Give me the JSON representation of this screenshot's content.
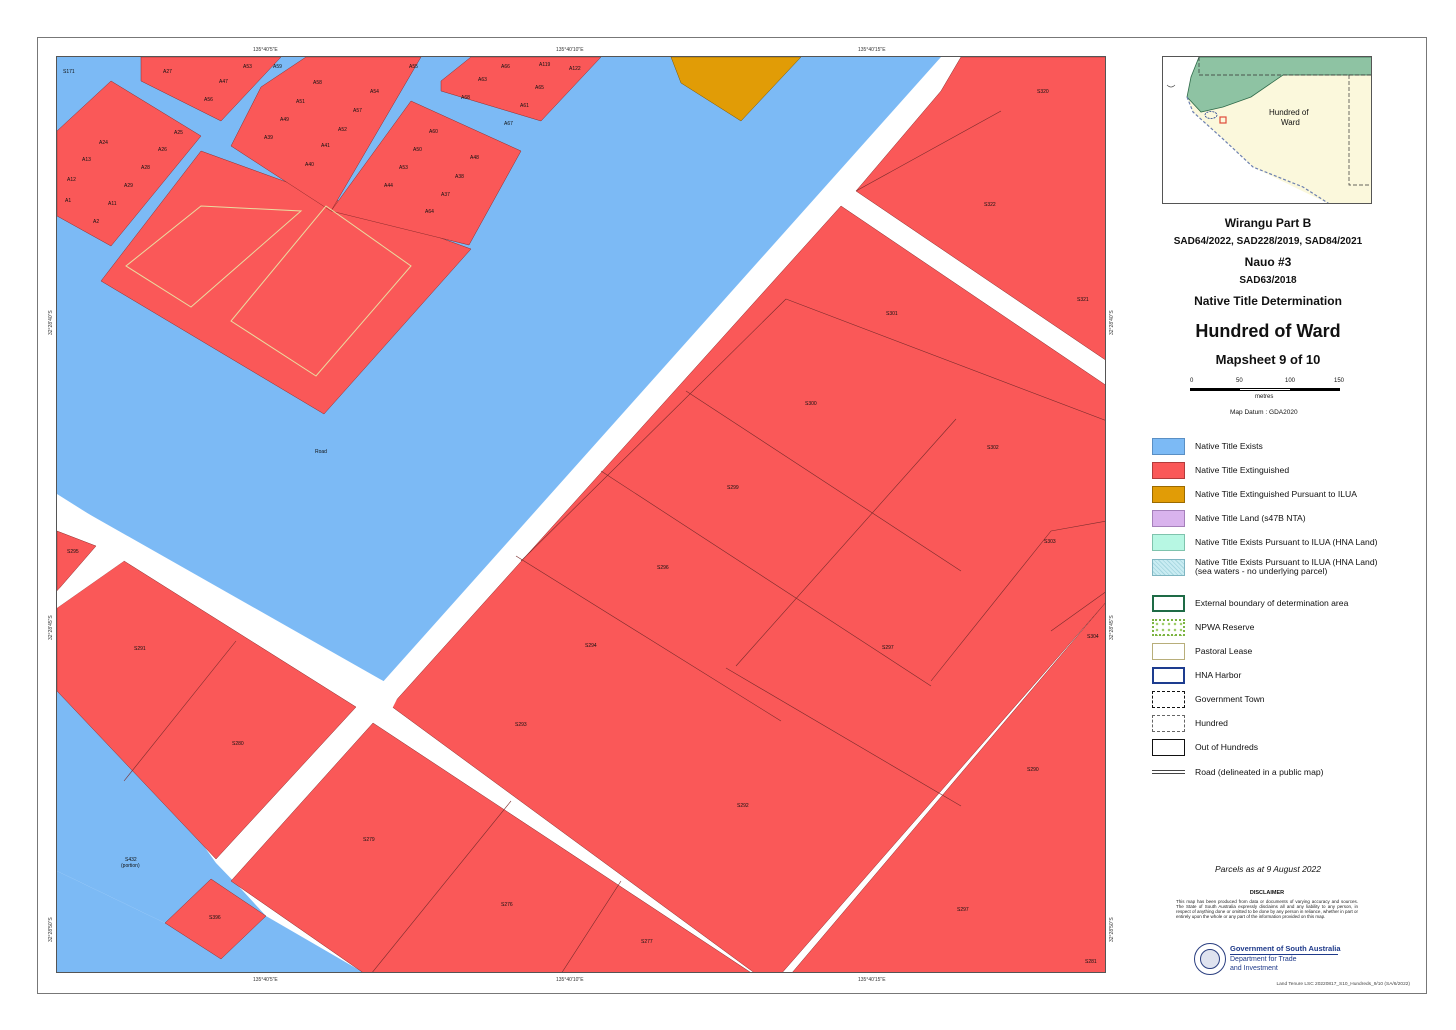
{
  "map": {
    "coords_top": [
      "135°40'5\"E",
      "135°40'10\"E",
      "135°40'15\"E"
    ],
    "coords_bottom": [
      "135°40'5\"E",
      "135°40'10\"E",
      "135°40'15\"E"
    ],
    "coords_left": [
      "32°28'40\"S",
      "32°28'45\"S",
      "32°28'50\"S"
    ],
    "coords_right": [
      "32°28'40\"S",
      "32°28'45\"S",
      "32°28'50\"S"
    ],
    "parcel_labels": {
      "s322": "S322",
      "s321": "S321",
      "s320": "S320",
      "s302": "S302",
      "s303": "S303",
      "s304": "S304",
      "s301": "S301",
      "s299": "S299",
      "s300": "S300",
      "s297": "S297",
      "s296": "S296",
      "s294": "S294",
      "s293": "S293",
      "s292": "S292",
      "s291": "S291",
      "s290": "S290",
      "s279": "S279",
      "s280": "S280",
      "s276": "S276",
      "s277": "S277",
      "s295": "S295",
      "s297b": "S297",
      "s281": "S281",
      "s432": "S432",
      "s432b": "(portion)",
      "s396": "S396",
      "road": "Road",
      "a1": "A1",
      "a2": "A2",
      "a11": "A11",
      "a12": "A12",
      "a13": "A13",
      "a24": "A24",
      "a25": "A25",
      "a26": "A26",
      "a27": "A27",
      "a28": "A28",
      "a29": "A29",
      "a37": "A37",
      "a38": "A38",
      "a39": "A39",
      "a40": "A40",
      "a41": "A41",
      "a44": "A44",
      "a47": "A47",
      "a48": "A48",
      "a49": "A49",
      "a50": "A50",
      "a51": "A51",
      "a52": "A52",
      "a53": "A53",
      "a54": "A54",
      "a55": "A55",
      "a56": "A56",
      "a57": "A57",
      "a58": "A58",
      "a59": "A59",
      "a60": "A60",
      "a61": "A61",
      "a62": "A62",
      "a63": "A63",
      "a64": "A64",
      "a65": "A65",
      "a66": "A66",
      "a67": "A67",
      "a68": "A68",
      "s171": "S171",
      "a119": "A119",
      "a122": "A122"
    }
  },
  "inset": {
    "label": "Hundred of\nWard",
    "label_l1": "Hundred of",
    "label_l2": "Ward"
  },
  "titles": {
    "claim1": "Wirangu Part B",
    "claim1_ids": "SAD64/2022, SAD228/2019, SAD84/2021",
    "claim2": "Nauo #3",
    "claim2_ids": "SAD63/2018",
    "determination": "Native Title Determination",
    "hundred": "Hundred of Ward",
    "mapsheet": "Mapsheet 9 of 10"
  },
  "scale": {
    "ticks": [
      "0",
      "50",
      "100",
      "150"
    ],
    "unit": "metres",
    "datum": "Map Datum : GDA2020"
  },
  "legend": [
    {
      "label": "Native Title Exists",
      "color": "#7cbaf5"
    },
    {
      "label": "Native Title Extinguished",
      "color": "#fa5858"
    },
    {
      "label": "Native Title Extinguished Pursuant to ILUA",
      "color": "#e19c06"
    },
    {
      "label": "Native Title Land (s47B NTA)",
      "color": "#d9b3ed"
    },
    {
      "label": "Native Title Exists Pursuant to ILUA (HNA Land)",
      "color": "#b7f7e3"
    },
    {
      "label": "Native Title Exists Pursuant to ILUA (HNA Land)",
      "label2": "(sea waters - no underlying parcel)",
      "color": "#c9ecf2"
    },
    {
      "label": "External boundary of determination area",
      "color": "#1e6b46"
    },
    {
      "label": "NPWA Reserve",
      "color": "#7cb342"
    },
    {
      "label": "Pastoral Lease",
      "color": "#b8ae7a"
    },
    {
      "label": "HNA Harbor",
      "color": "#1d3c8f"
    },
    {
      "label": "Government Town",
      "color": "#111111"
    },
    {
      "label": "Hundred",
      "color": "#666666"
    },
    {
      "label": "Out of Hundreds",
      "color": "#111111"
    },
    {
      "label": "Road (delineated in a public map)",
      "color": "#444444"
    }
  ],
  "parcels_date": "Parcels as at 9 August 2022",
  "disclaimer": {
    "title": "DISCLAIMER",
    "text": "This map has been produced from data or documents of varying accuracy and sources. The State of South Australia expressly disclaims all and any liability to any person, in respect of anything done or omitted to be done by any person in reliance, whether in part or entirely upon the whole or any part of the information provided on this map."
  },
  "gov": {
    "line1": "Government of South Australia",
    "line2": "Department for Trade",
    "line3": "and Investment"
  },
  "footer": "Land Tenure LSC 20220817_S10_Hundreds_9/10 (SA/6/2022)"
}
